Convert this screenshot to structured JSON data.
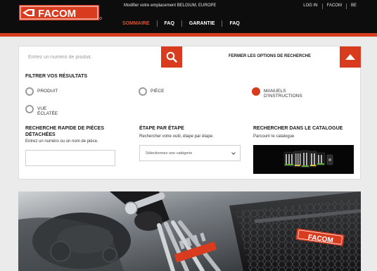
{
  "header": {
    "logo_text": "FACOM",
    "locale_message": "Modifier votre emplacement BELGIUM, EUROPE",
    "utility_links": [
      "LOG IN",
      "FACOM",
      "BE"
    ],
    "nav": [
      {
        "label": "SOMMAIRE",
        "active": true
      },
      {
        "label": "FAQ",
        "active": false
      },
      {
        "label": "GARANTIE",
        "active": false
      },
      {
        "label": "FAQ",
        "active": false
      }
    ]
  },
  "search": {
    "placeholder": "Entrez un numéro de produit.",
    "close_options_label": "FERMER LES OPTIONS DE RECHERCHE"
  },
  "filters": {
    "title": "FILTRER VOS RÉSULTATS",
    "options": [
      {
        "label": "PRODUIT",
        "selected": false
      },
      {
        "label": "PIÈCE",
        "selected": false
      },
      {
        "label": "MANUELS D'INSTRUCTIONS",
        "selected": true
      },
      {
        "label": "VUE ÉCLATÉE",
        "selected": false
      }
    ]
  },
  "quick_search": {
    "title": "RECHERCHE RAPIDE DE PIÈCES DÉTACHÉES",
    "description": "Entrez un numéro ou un nom de pièce."
  },
  "step_by_step": {
    "title": "ÉTAPE PAR ÉTAPE",
    "description": "Rechercher votre outil, étape par étape.",
    "select_value": "Sélectionnez une catégorie"
  },
  "catalog": {
    "title": "RECHERCHER DANS LE CATALOGUE",
    "description": "Parcourir le catalogue"
  },
  "colors": {
    "brand_red": "#d93b1f",
    "header_bg": "#0d0d0d",
    "page_bg": "#ebebeb"
  },
  "icons": [
    "facom-logo-icon",
    "search-icon",
    "chevron-up-icon",
    "chevron-down-icon"
  ]
}
